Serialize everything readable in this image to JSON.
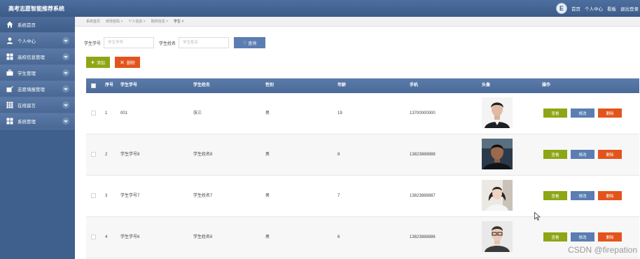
{
  "app": {
    "title": "高考志愿智能推荐系统"
  },
  "topbar": {
    "avatar_initial": "E",
    "links": [
      "首页",
      "个人中心",
      "看板",
      "退出登录"
    ]
  },
  "sidebar": {
    "items": [
      {
        "label": "系统首页",
        "icon": "home-icon",
        "has_chevron": false
      },
      {
        "label": "个人中心",
        "icon": "user-icon",
        "has_chevron": true
      },
      {
        "label": "高校信息管理",
        "icon": "grid-icon",
        "has_chevron": true
      },
      {
        "label": "学生管理",
        "icon": "briefcase-icon",
        "has_chevron": true
      },
      {
        "label": "志愿填报管理",
        "icon": "edit-doc-icon",
        "has_chevron": true
      },
      {
        "label": "在线留言",
        "icon": "apps-icon",
        "has_chevron": true
      },
      {
        "label": "系统管理",
        "icon": "grid-icon",
        "has_chevron": true
      }
    ]
  },
  "tabs": [
    {
      "label": "系统首页",
      "closable": false,
      "active": false
    },
    {
      "label": "修改密码",
      "closable": true,
      "active": false
    },
    {
      "label": "个人信息",
      "closable": true,
      "active": false
    },
    {
      "label": "院校信息",
      "closable": true,
      "active": false
    },
    {
      "label": "学生",
      "closable": true,
      "active": true
    }
  ],
  "search": {
    "student_id_label": "学生学号",
    "student_id_placeholder": "学生学号",
    "student_name_label": "学生姓名",
    "student_name_placeholder": "学生姓名",
    "query_button": "查询"
  },
  "actions": {
    "add": "添加",
    "delete": "删除"
  },
  "table": {
    "headers": [
      "序号",
      "学生学号",
      "学生姓名",
      "性别",
      "年龄",
      "手机",
      "头像",
      "操作"
    ],
    "rows": [
      {
        "index": "1",
        "student_id": "001",
        "name": "张三",
        "gender": "男",
        "age": "19",
        "phone": "13700000000",
        "avatar": "photo-man-suit"
      },
      {
        "index": "2",
        "student_id": "学生学号8",
        "name": "学生姓名8",
        "gender": "男",
        "age": "8",
        "phone": "13823888888",
        "avatar": "photo-man-dark"
      },
      {
        "index": "3",
        "student_id": "学生学号7",
        "name": "学生姓名7",
        "gender": "男",
        "age": "7",
        "phone": "13823888887",
        "avatar": "photo-girl"
      },
      {
        "index": "4",
        "student_id": "学生学号6",
        "name": "学生姓名6",
        "gender": "男",
        "age": "6",
        "phone": "13823888886",
        "avatar": "photo-man-glasses"
      }
    ],
    "row_buttons": {
      "view": "查看",
      "edit": "修改",
      "delete": "删除"
    }
  },
  "watermark": "CSDN @firepation",
  "colors": {
    "topbar": "#4d6f9f",
    "sidebar": "#4a6894",
    "table_header": "#5b7bab",
    "btn_green": "#8da615",
    "btn_blue": "#5b7db1",
    "btn_red": "#e3541c"
  }
}
